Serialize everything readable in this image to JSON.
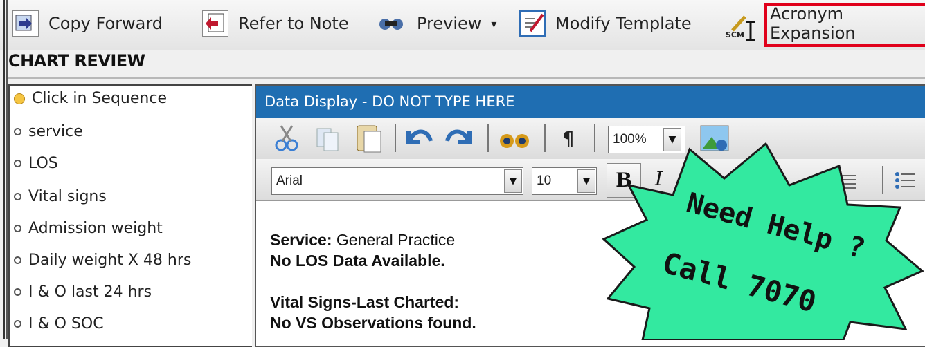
{
  "toolbar": {
    "copy_forward": "Copy Forward",
    "refer_to_note": "Refer to Note",
    "preview": "Preview",
    "preview_caret": "▾",
    "modify_template": "Modify Template",
    "scm_icon_text": "SCM",
    "acronym_expansion": "Acronym Expansion",
    "highlight_color": "#e0001a"
  },
  "chart_review": {
    "title": "CHART REVIEW",
    "items": [
      {
        "label": "Click in Sequence"
      },
      {
        "label": "service"
      },
      {
        "label": "LOS"
      },
      {
        "label": "Vital signs"
      },
      {
        "label": "Admission weight"
      },
      {
        "label": "Daily weight X 48 hrs"
      },
      {
        "label": "I & O last 24 hrs"
      },
      {
        "label": "I & O SOC"
      }
    ]
  },
  "data_display": {
    "title": "Data Display - DO NOT TYPE HERE",
    "title_bar_color": "#1f6eb2",
    "zoom": "100%",
    "font_name": "Arial",
    "font_size": "10",
    "bold_label": "B",
    "italic_label": "I",
    "pilcrow": "¶",
    "lines": {
      "service_label": "Service:",
      "service_value": "General Practice",
      "los": "No LOS Data Available.",
      "vital_signs_header": "Vital Signs-Last Charted:",
      "vs_none": "No VS Observations found."
    }
  },
  "help_burst": {
    "line1": "Need Help ?",
    "line2": "Call 7070",
    "fill_color": "#33e9a0"
  }
}
